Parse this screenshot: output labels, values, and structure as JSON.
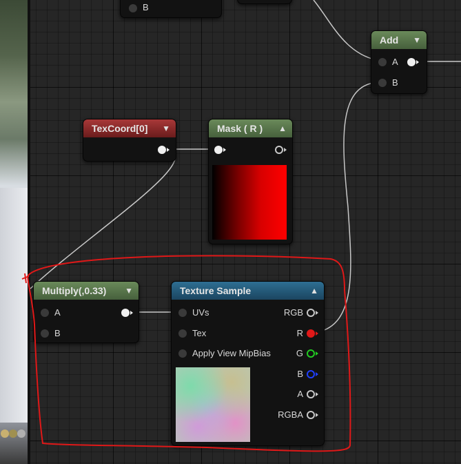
{
  "nodes": {
    "top_left": {
      "pin_b": "B"
    },
    "add": {
      "title": "Add",
      "pin_a": "A",
      "pin_b": "B"
    },
    "texcoord": {
      "title": "TexCoord[0]"
    },
    "mask": {
      "title": "Mask ( R )"
    },
    "multiply": {
      "title": "Multiply(,0.33)",
      "pin_a": "A",
      "pin_b": "B"
    },
    "texture_sample": {
      "title": "Texture Sample",
      "inputs": [
        "UVs",
        "Tex",
        "Apply View MipBias"
      ],
      "outputs": [
        "RGB",
        "R",
        "G",
        "B",
        "A",
        "RGBA"
      ]
    }
  },
  "colors": {
    "graph_bg": "#262626",
    "header_green": "#5a7a4a",
    "header_red": "#8b2a2a",
    "header_blue": "#2a6688",
    "annotation": "#e01818",
    "pin_r": "#e01818",
    "pin_g": "#22cc22",
    "pin_b": "#2040ff"
  }
}
